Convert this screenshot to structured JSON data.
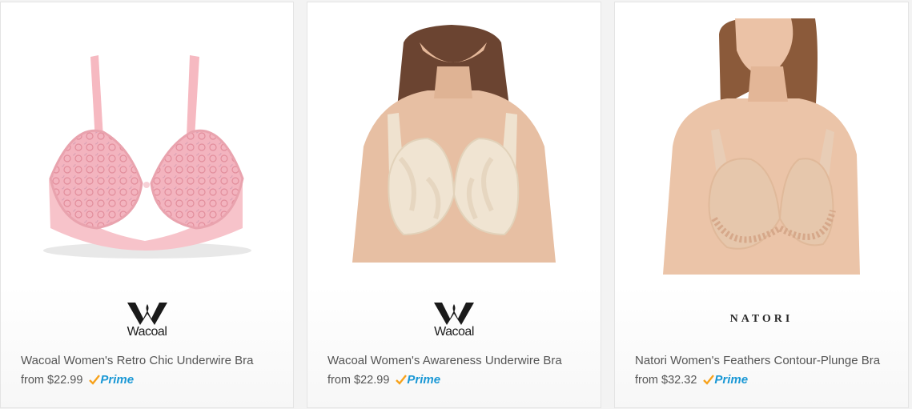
{
  "products": [
    {
      "brand": "Wacoal",
      "brand_logo_text": "Wacoal",
      "title": "Wacoal Women's Retro Chic Underwire Bra",
      "price_prefix": "from",
      "price": "$22.99",
      "badge": "Prime",
      "image_icon": "pink-lace-bra-image",
      "color": "#f4b8c0"
    },
    {
      "brand": "Wacoal",
      "brand_logo_text": "Wacoal",
      "title": "Wacoal Women's Awareness Underwire Bra",
      "price_prefix": "from",
      "price": "$22.99",
      "badge": "Prime",
      "image_icon": "model-beige-bra-image",
      "color": "#efe2cf"
    },
    {
      "brand": "Natori",
      "brand_logo_text": "NATORI",
      "title": "Natori Women's Feathers Contour-Plunge Bra",
      "price_prefix": "from",
      "price": "$32.32",
      "badge": "Prime",
      "image_icon": "model-nude-bra-image",
      "color": "#e8cdb6"
    }
  ],
  "colors": {
    "prime_blue": "#1a98d5",
    "prime_check": "#f7a21b",
    "text_gray": "#555555"
  }
}
